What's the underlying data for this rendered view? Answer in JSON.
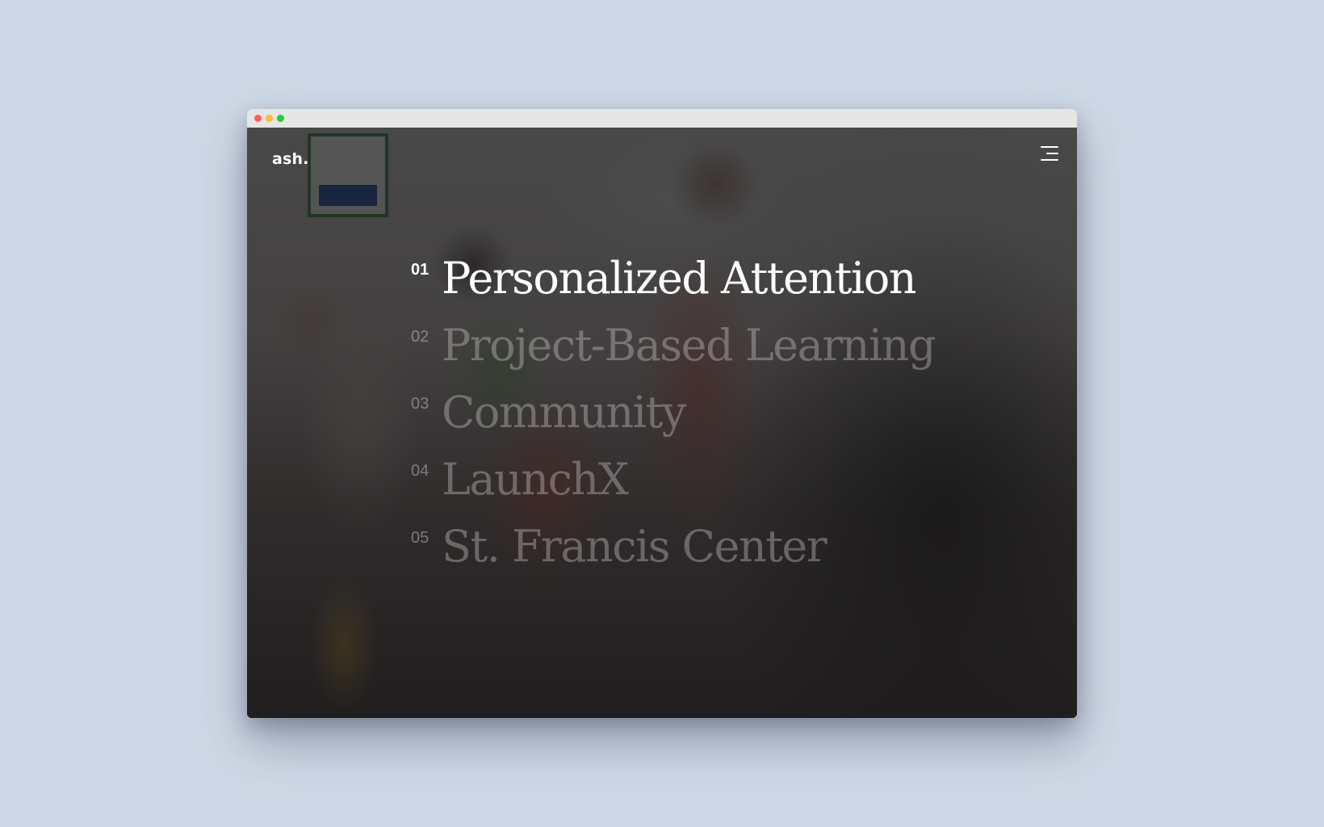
{
  "brand": {
    "logo": "ash."
  },
  "nav": {
    "items": [
      {
        "number": "01",
        "label": "Personalized Attention"
      },
      {
        "number": "02",
        "label": "Project-Based Learning"
      },
      {
        "number": "03",
        "label": "Community"
      },
      {
        "number": "04",
        "label": "LaunchX"
      },
      {
        "number": "05",
        "label": "St. Francis Center"
      }
    ],
    "active_index": 0
  },
  "icons": {
    "menu": "hamburger-menu-icon"
  },
  "colors": {
    "page_background": "#cfd8e6",
    "overlay": "#181618",
    "active_text": "#ffffff",
    "inactive_text": "#c8c3c3"
  }
}
